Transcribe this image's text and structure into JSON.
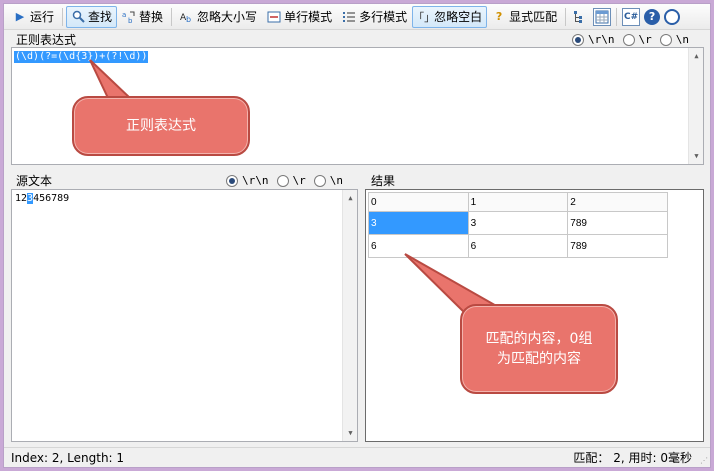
{
  "toolbar": {
    "run": "运行",
    "find": "查找",
    "replace": "替换",
    "ignore_case": "忽略大小写",
    "single_line": "单行模式",
    "multi_line": "多行模式",
    "ignore_whitespace": "忽略空白",
    "explicit_capture": "显式匹配"
  },
  "regex_panel": {
    "title": "正则表达式",
    "options": [
      "\\r\\n",
      "\\r",
      "\\n"
    ],
    "selected_option": "\\r\\n",
    "value": "(\\d)(?=(\\d{3})+(?!\\d))"
  },
  "source_panel": {
    "title": "源文本",
    "options": [
      "\\r\\n",
      "\\r",
      "\\n"
    ],
    "selected_option": "\\r\\n",
    "text_before": "12",
    "text_highlight": "3",
    "text_after": "456789"
  },
  "result_panel": {
    "title": "结果",
    "columns": [
      "0",
      "1",
      "2"
    ],
    "rows": [
      [
        "3",
        "3",
        "789"
      ],
      [
        "6",
        "6",
        "789"
      ]
    ]
  },
  "callouts": {
    "regex": "正则表达式",
    "result_line1": "匹配的内容，0组",
    "result_line2": "为匹配的内容"
  },
  "status": {
    "left": "Index: 2, Length: 1",
    "right": "匹配： 2, 用时: 0毫秒"
  },
  "colors": {
    "accent": "#3399ff",
    "callout": "#e9746c",
    "frame": "#c9a9d6"
  }
}
